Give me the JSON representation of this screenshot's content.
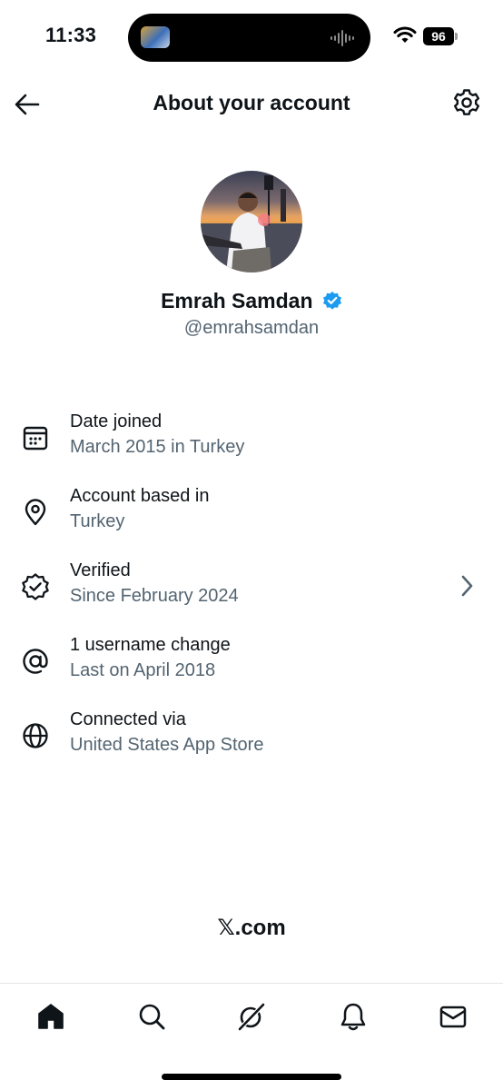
{
  "status_bar": {
    "time": "11:33",
    "battery": "96"
  },
  "header": {
    "title": "About your account"
  },
  "profile": {
    "name": "Emrah Samdan",
    "handle": "@emrahsamdan"
  },
  "info_items": [
    {
      "icon": "calendar-icon",
      "title": "Date joined",
      "subtitle": "March 2015 in Turkey"
    },
    {
      "icon": "location-pin-icon",
      "title": "Account based in",
      "subtitle": "Turkey"
    },
    {
      "icon": "verified-badge-icon",
      "title": "Verified",
      "subtitle": "Since February 2024"
    },
    {
      "icon": "at-sign-icon",
      "title": "1 username change",
      "subtitle": "Last on April 2018"
    },
    {
      "icon": "globe-icon",
      "title": "Connected via",
      "subtitle": "United States App Store"
    }
  ],
  "footer": {
    "brand": "𝕏.com"
  },
  "tab_bar": [
    "home-icon",
    "search-icon",
    "grok-icon",
    "notifications-icon",
    "messages-icon"
  ],
  "colors": {
    "text": "#0f1419",
    "secondary": "#536471",
    "verified_blue": "#1d9bf0",
    "background": "#ffffff"
  }
}
